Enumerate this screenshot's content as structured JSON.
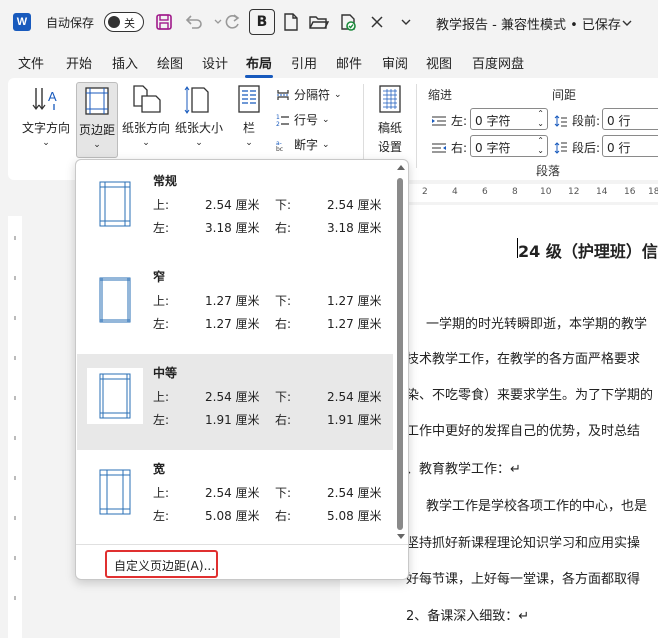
{
  "titlebar": {
    "logo": "W",
    "autosave_label": "自动保存",
    "toggle_state": "关",
    "document_title": "教学报告 - 兼容性模式 • 已保存",
    "icons": [
      "save-icon",
      "undo-icon",
      "redo-icon",
      "bold-icon",
      "new-file-icon",
      "open-folder-icon",
      "sync-icon",
      "close-icon",
      "more-icon"
    ],
    "bold_glyph": "B"
  },
  "menu": {
    "tabs": [
      "文件",
      "开始",
      "插入",
      "绘图",
      "设计",
      "布局",
      "引用",
      "邮件",
      "审阅",
      "视图",
      "百度网盘"
    ],
    "active": "布局"
  },
  "ribbon": {
    "text_direction": "文字方向",
    "margins": "页边距",
    "orientation": "纸张方向",
    "size": "纸张大小",
    "columns": "栏",
    "breaks": "分隔符",
    "line_numbers": "行号",
    "hyphenation": "断字",
    "draft_settings_line1": "稿纸",
    "draft_settings_line2": "设置",
    "indent_label": "缩进",
    "spacing_label": "间距",
    "left_label": "左:",
    "right_label": "右:",
    "left_value": "0 字符",
    "right_value": "0 字符",
    "before_label": "段前:",
    "after_label": "段后:",
    "before_value": "0 行",
    "after_value": "0 行",
    "paragraph_group": "段落"
  },
  "dropdown": {
    "options": [
      {
        "name": "常规",
        "top_label": "上:",
        "top": "2.54 厘米",
        "bottom_label": "下:",
        "bottom": "2.54 厘米",
        "left_label": "左:",
        "left": "3.18 厘米",
        "right_label": "右:",
        "right": "3.18 厘米"
      },
      {
        "name": "窄",
        "top_label": "上:",
        "top": "1.27 厘米",
        "bottom_label": "下:",
        "bottom": "1.27 厘米",
        "left_label": "左:",
        "left": "1.27 厘米",
        "right_label": "右:",
        "right": "1.27 厘米"
      },
      {
        "name": "中等",
        "top_label": "上:",
        "top": "2.54 厘米",
        "bottom_label": "下:",
        "bottom": "2.54 厘米",
        "left_label": "左:",
        "left": "1.91 厘米",
        "right_label": "右:",
        "right": "1.91 厘米"
      },
      {
        "name": "宽",
        "top_label": "上:",
        "top": "2.54 厘米",
        "bottom_label": "下:",
        "bottom": "2.54 厘米",
        "left_label": "左:",
        "left": "5.08 厘米",
        "right_label": "右:",
        "right": "5.08 厘米"
      }
    ],
    "highlighted_index": 2,
    "custom_margins": "自定义页边距(A)..."
  },
  "document": {
    "ruler_marks": [
      "2",
      "4",
      "6",
      "8",
      "10",
      "12",
      "14",
      "16",
      "18"
    ],
    "heading": "24 级（护理班）信",
    "lines": [
      "一学期的时光转瞬即逝，本学期的教学",
      "技术教学工作，在教学的各方面严格要求",
      "染、不吃零食）来要求学生。为了下学期的",
      "工作中更好的发挥自己的优势，及时总结",
      "、教育教学工作：↵",
      "教学工作是学校各项工作的中心，也是",
      "坚持抓好新课程理论知识学习和应用实操",
      "好每节课，上好每一堂课，各方面都取得",
      "2、备课深入细致：↵"
    ]
  },
  "colors": {
    "accent": "#185abd",
    "highlight_border": "#e03030",
    "margin_line": "#2a6fb5"
  }
}
